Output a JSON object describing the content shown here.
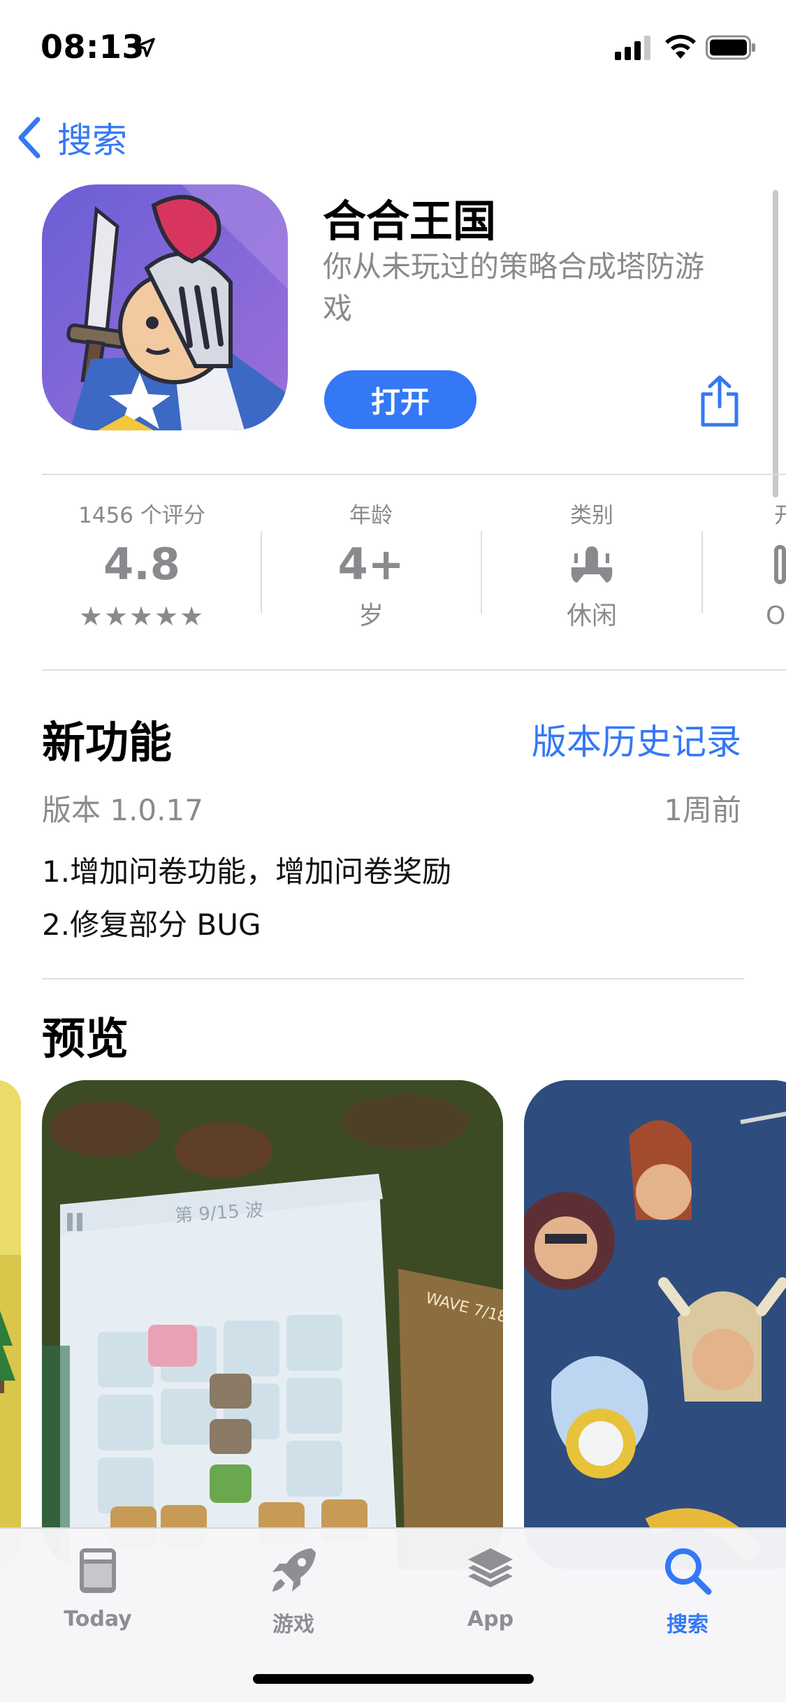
{
  "status_bar": {
    "time": "08:13"
  },
  "nav": {
    "back_label": "搜索"
  },
  "app": {
    "title": "合合王国",
    "subtitle": "你从未玩过的策略合成塔防游戏",
    "open_label": "打开"
  },
  "info": {
    "ratings": {
      "label": "1456 个评分",
      "value": "4.8",
      "stars": "★★★★★",
      "rating_value": 4.8
    },
    "age": {
      "label": "年龄",
      "value": "4+",
      "sub": "岁"
    },
    "category": {
      "label": "类别",
      "sub": "休闲"
    },
    "partial": {
      "label": "开",
      "sub": "OI"
    }
  },
  "whats_new": {
    "title": "新功能",
    "history_link": "版本历史记录",
    "version": "版本 1.0.17",
    "updated": "1周前",
    "notes": [
      "1.增加问卷功能，增加问卷奖励",
      "2.修复部分 BUG"
    ]
  },
  "preview": {
    "title": "预览",
    "screenshot_text": {
      "wave_cn": "第 9/15 波",
      "wave_en": "WAVE 7/18"
    }
  },
  "tabs": [
    {
      "label": "Today",
      "icon": "today-icon"
    },
    {
      "label": "游戏",
      "icon": "rocket-icon"
    },
    {
      "label": "App",
      "icon": "layers-icon"
    },
    {
      "label": "搜索",
      "icon": "search-icon",
      "active": true
    }
  ],
  "colors": {
    "accent": "#3478f6",
    "secondary_text": "#8a8a8e",
    "separator": "#dedee2"
  }
}
